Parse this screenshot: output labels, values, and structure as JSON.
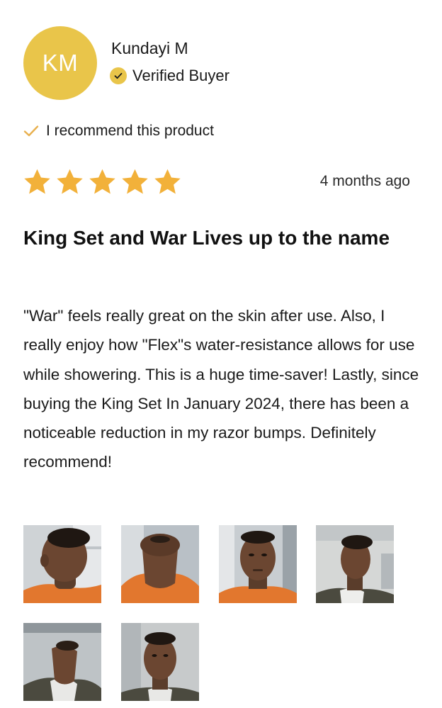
{
  "reviewer": {
    "initials": "KM",
    "name": "Kundayi M",
    "badge": "Verified Buyer"
  },
  "recommendation": "I recommend this product",
  "rating": {
    "stars": 5,
    "max": 5
  },
  "date": "4 months ago",
  "review": {
    "title": "King Set and War Lives up to the name",
    "body": "\"War\" feels really great on the skin after use. Also, I really enjoy how \"Flex\"s water-resistance allows for use while showering. This is a huge time-saver! Lastly, since buying the King Set In January 2024, there has been a noticeable reduction in my razor bumps. Definitely recommend!"
  },
  "photos": [
    {
      "subject": "side profile, orange hoodie"
    },
    {
      "subject": "chin raised, orange hoodie"
    },
    {
      "subject": "front face, orange hoodie"
    },
    {
      "subject": "side profile, grey shirt"
    },
    {
      "subject": "chin raised, grey shirt"
    },
    {
      "subject": "front face, grey shirt"
    }
  ],
  "colors": {
    "accent": "#e9c54a",
    "star": "#f2b13a",
    "check": "#e8b04e",
    "text": "#1a1a1a"
  }
}
